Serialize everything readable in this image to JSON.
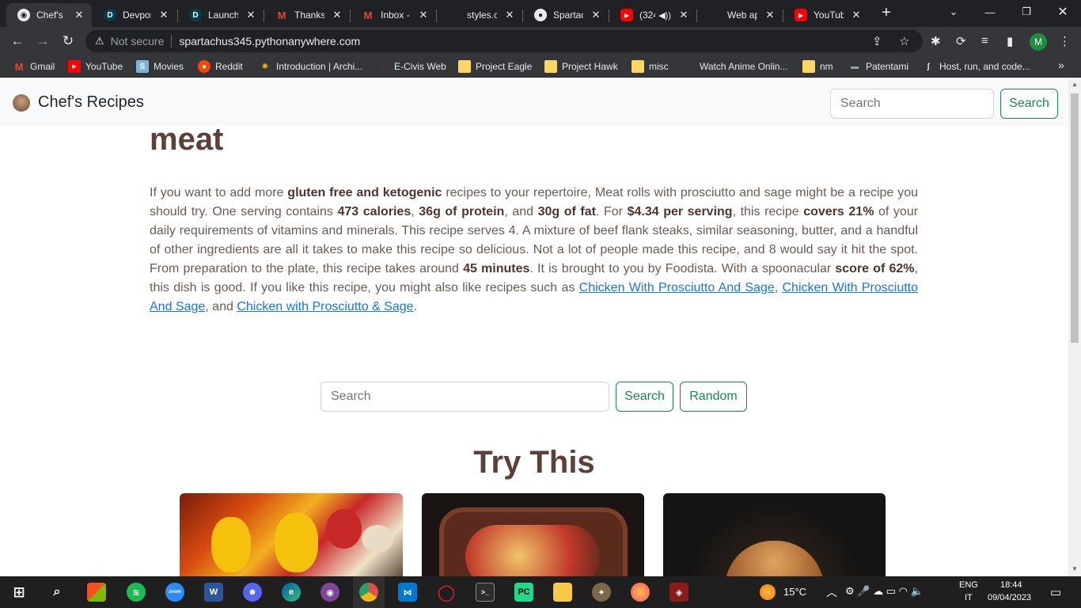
{
  "browser": {
    "tabs": [
      {
        "label": "Chef's Recipes",
        "icon": "chrome-icon",
        "active": true
      },
      {
        "label": "Devpost",
        "icon": "devpost-icon"
      },
      {
        "label": "LaunchHacks",
        "icon": "devpost-icon"
      },
      {
        "label": "Thanks for",
        "icon": "gmail-icon"
      },
      {
        "label": "Inbox - ",
        "icon": "gmail-icon"
      },
      {
        "label": "styles.css",
        "icon": "file-icon"
      },
      {
        "label": "Spartachus",
        "icon": "github-icon"
      },
      {
        "label": "(324",
        "icon": "youtube-icon"
      },
      {
        "label": "Web app",
        "icon": "web-icon"
      },
      {
        "label": "YouTube",
        "icon": "youtube-icon"
      }
    ],
    "not_secure": "Not secure",
    "url": "spartachus345.pythonanywhere.com",
    "profile_initial": "M",
    "bookmarks": [
      "Gmail",
      "YouTube",
      "Movies",
      "Reddit",
      "Introduction | Archi...",
      "E-Civis Web",
      "Project Eagle",
      "Project Hawk",
      "misc",
      "Watch Anime Onlin...",
      "nm",
      "Patentami",
      "Host, run, and code..."
    ],
    "more_bookmarks": "»"
  },
  "site": {
    "brand": "Chef's Recipes",
    "nav_search_placeholder": "Search",
    "nav_search_button": "Search"
  },
  "recipe": {
    "title_tail": "meat",
    "p1": "If you want to add more ",
    "b1": "gluten free and ketogenic",
    "p2": " recipes to your repertoire, Meat rolls with prosciutto and sage might be a recipe you should try. One serving contains ",
    "b2": "473 calories",
    "p3": ", ",
    "b3": "36g of protein",
    "p4": ", and ",
    "b4": "30g of fat",
    "p5": ". For ",
    "b5": "$4.34 per serving",
    "p6": ", this recipe ",
    "b6": "covers 21%",
    "p7": " of your daily requirements of vitamins and minerals. This recipe serves 4. A mixture of beef flank steaks, similar seasoning, butter, and a handful of other ingredients are all it takes to make this recipe so delicious. Not a lot of people made this recipe, and 8 would say it hit the spot. From preparation to the plate, this recipe takes around ",
    "b7": "45 minutes",
    "p8": ". It is brought to you by Foodista. With a spoonacular ",
    "b8": "score of 62%",
    "p9": ", this dish is good. If you like this recipe, you might also like recipes such as ",
    "link1": "Chicken With Prosciutto And Sage",
    "p10": ", ",
    "link2": "Chicken With Prosciutto And Sage",
    "p11": ", and ",
    "link3": "Chicken with Prosciutto & Sage",
    "p12": "."
  },
  "search": {
    "placeholder": "Search",
    "search_button": "Search",
    "random_button": "Random"
  },
  "try_this": {
    "heading": "Try This"
  },
  "taskbar": {
    "weather": "15°C",
    "lang": "ENG",
    "region": "IT",
    "time": "18:44",
    "date": "09/04/2023"
  },
  "colors": {
    "accent_green": "#198754",
    "heading_brown": "#5d4037",
    "link_blue": "#1a73e8"
  }
}
